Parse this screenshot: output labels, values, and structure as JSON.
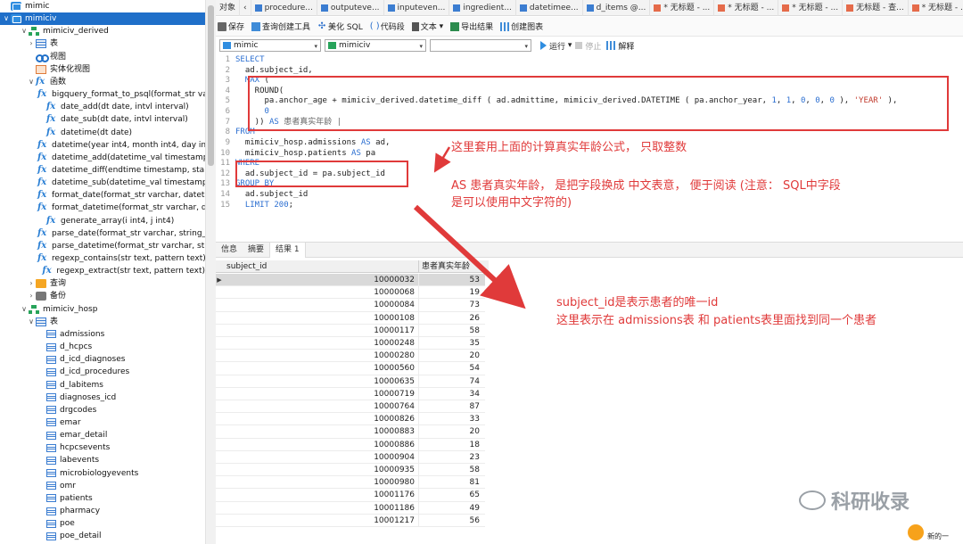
{
  "sidebar": {
    "rows": [
      {
        "label": "mimic",
        "icon": "db-icon",
        "chev": "",
        "indent": 0,
        "selected": false
      },
      {
        "label": "mimiciv",
        "icon": "db-icon",
        "chev": "∨",
        "indent": 0,
        "selected": true
      },
      {
        "label": "mimiciv_derived",
        "icon": "schema-icon",
        "chev": "∨",
        "indent": 1,
        "selected": false
      },
      {
        "label": "表",
        "icon": "table-icon",
        "chev": "›",
        "indent": 2,
        "selected": false
      },
      {
        "label": "视图",
        "icon": "view-icon",
        "chev": "",
        "indent": 2,
        "selected": false
      },
      {
        "label": "实体化视图",
        "icon": "materialized-view-icon",
        "chev": "",
        "indent": 2,
        "selected": false
      },
      {
        "label": "函数",
        "icon": "function-icon",
        "chev": "∨",
        "indent": 2,
        "selected": false
      },
      {
        "label": "bigquery_format_to_psql(format_str va",
        "icon": "function-icon",
        "chev": "",
        "indent": 3,
        "selected": false
      },
      {
        "label": "date_add(dt date, intvl interval)",
        "icon": "function-icon",
        "chev": "",
        "indent": 3,
        "selected": false
      },
      {
        "label": "date_sub(dt date, intvl interval)",
        "icon": "function-icon",
        "chev": "",
        "indent": 3,
        "selected": false
      },
      {
        "label": "datetime(dt date)",
        "icon": "function-icon",
        "chev": "",
        "indent": 3,
        "selected": false
      },
      {
        "label": "datetime(year int4, month int4, day int",
        "icon": "function-icon",
        "chev": "",
        "indent": 3,
        "selected": false
      },
      {
        "label": "datetime_add(datetime_val timestamp,",
        "icon": "function-icon",
        "chev": "",
        "indent": 3,
        "selected": false
      },
      {
        "label": "datetime_diff(endtime timestamp, start",
        "icon": "function-icon",
        "chev": "",
        "indent": 3,
        "selected": false
      },
      {
        "label": "datetime_sub(datetime_val timestamp,",
        "icon": "function-icon",
        "chev": "",
        "indent": 3,
        "selected": false
      },
      {
        "label": "format_date(format_str varchar, datetir",
        "icon": "function-icon",
        "chev": "",
        "indent": 3,
        "selected": false
      },
      {
        "label": "format_datetime(format_str varchar, da",
        "icon": "function-icon",
        "chev": "",
        "indent": 3,
        "selected": false
      },
      {
        "label": "generate_array(i int4, j int4)",
        "icon": "function-icon",
        "chev": "",
        "indent": 3,
        "selected": false
      },
      {
        "label": "parse_date(format_str varchar, string_v",
        "icon": "function-icon",
        "chev": "",
        "indent": 3,
        "selected": false
      },
      {
        "label": "parse_datetime(format_str varchar, stri",
        "icon": "function-icon",
        "chev": "",
        "indent": 3,
        "selected": false
      },
      {
        "label": "regexp_contains(str text, pattern text)",
        "icon": "function-icon",
        "chev": "",
        "indent": 3,
        "selected": false
      },
      {
        "label": "regexp_extract(str text, pattern text)",
        "icon": "function-icon",
        "chev": "",
        "indent": 3,
        "selected": false
      },
      {
        "label": "查询",
        "icon": "query-icon",
        "chev": "›",
        "indent": 2,
        "selected": false
      },
      {
        "label": "备份",
        "icon": "backup-icon",
        "chev": "›",
        "indent": 2,
        "selected": false
      },
      {
        "label": "mimiciv_hosp",
        "icon": "schema-icon",
        "chev": "∨",
        "indent": 1,
        "selected": false
      },
      {
        "label": "表",
        "icon": "table-icon",
        "chev": "∨",
        "indent": 2,
        "selected": false
      },
      {
        "label": "admissions",
        "icon": "table-small-icon",
        "chev": "",
        "indent": 3,
        "selected": false
      },
      {
        "label": "d_hcpcs",
        "icon": "table-small-icon",
        "chev": "",
        "indent": 3,
        "selected": false
      },
      {
        "label": "d_icd_diagnoses",
        "icon": "table-small-icon",
        "chev": "",
        "indent": 3,
        "selected": false
      },
      {
        "label": "d_icd_procedures",
        "icon": "table-small-icon",
        "chev": "",
        "indent": 3,
        "selected": false
      },
      {
        "label": "d_labitems",
        "icon": "table-small-icon",
        "chev": "",
        "indent": 3,
        "selected": false
      },
      {
        "label": "diagnoses_icd",
        "icon": "table-small-icon",
        "chev": "",
        "indent": 3,
        "selected": false
      },
      {
        "label": "drgcodes",
        "icon": "table-small-icon",
        "chev": "",
        "indent": 3,
        "selected": false
      },
      {
        "label": "emar",
        "icon": "table-small-icon",
        "chev": "",
        "indent": 3,
        "selected": false
      },
      {
        "label": "emar_detail",
        "icon": "table-small-icon",
        "chev": "",
        "indent": 3,
        "selected": false
      },
      {
        "label": "hcpcsevents",
        "icon": "table-small-icon",
        "chev": "",
        "indent": 3,
        "selected": false
      },
      {
        "label": "labevents",
        "icon": "table-small-icon",
        "chev": "",
        "indent": 3,
        "selected": false
      },
      {
        "label": "microbiologyevents",
        "icon": "table-small-icon",
        "chev": "",
        "indent": 3,
        "selected": false
      },
      {
        "label": "omr",
        "icon": "table-small-icon",
        "chev": "",
        "indent": 3,
        "selected": false
      },
      {
        "label": "patients",
        "icon": "table-small-icon",
        "chev": "",
        "indent": 3,
        "selected": false
      },
      {
        "label": "pharmacy",
        "icon": "table-small-icon",
        "chev": "",
        "indent": 3,
        "selected": false
      },
      {
        "label": "poe",
        "icon": "table-small-icon",
        "chev": "",
        "indent": 3,
        "selected": false
      },
      {
        "label": "poe_detail",
        "icon": "table-small-icon",
        "chev": "",
        "indent": 3,
        "selected": false
      }
    ]
  },
  "tabs": {
    "objects_label": "对象",
    "items": [
      {
        "label": "procedure...",
        "icon": "table"
      },
      {
        "label": "outputeve...",
        "icon": "table"
      },
      {
        "label": "inputeven...",
        "icon": "table"
      },
      {
        "label": "ingredient...",
        "icon": "table"
      },
      {
        "label": "datetimee...",
        "icon": "table"
      },
      {
        "label": "d_items @...",
        "icon": "table"
      },
      {
        "label": "* 无标题 - ...",
        "icon": "query"
      },
      {
        "label": "* 无标题 - ...",
        "icon": "query"
      },
      {
        "label": "* 无标题 - ...",
        "icon": "query"
      },
      {
        "label": "无标题 - 查...",
        "icon": "query"
      },
      {
        "label": "* 无标题 - ...",
        "icon": "query"
      }
    ]
  },
  "toolbar": {
    "save": "保存",
    "build_query": "查询创建工具",
    "beautify": "美化 SQL",
    "code_snippet": "代码段",
    "text": "文本",
    "export": "导出结果",
    "create_chart": "创建图表"
  },
  "conn_bar": {
    "connection": "mimic",
    "database": "mimiciv",
    "schema": "",
    "run": "运行",
    "stop": "停止",
    "explain": "解释"
  },
  "editor": {
    "lines": [
      {
        "n": "1",
        "segs": [
          {
            "t": "SELECT",
            "c": "kw"
          }
        ]
      },
      {
        "n": "2",
        "segs": [
          {
            "t": "  ad.subject_id,",
            "c": ""
          }
        ]
      },
      {
        "n": "3",
        "segs": [
          {
            "t": "  ",
            "c": ""
          },
          {
            "t": "MAX",
            "c": "kw"
          },
          {
            "t": " (",
            "c": ""
          }
        ]
      },
      {
        "n": "4",
        "segs": [
          {
            "t": "    ROUND(",
            "c": ""
          }
        ]
      },
      {
        "n": "5",
        "segs": [
          {
            "t": "      pa.anchor_age + mimiciv_derived.datetime_diff ( ad.admittime, mimiciv_derived.DATETIME ( pa.anchor_year, ",
            "c": ""
          },
          {
            "t": "1",
            "c": "num"
          },
          {
            "t": ", ",
            "c": ""
          },
          {
            "t": "1",
            "c": "num"
          },
          {
            "t": ", ",
            "c": ""
          },
          {
            "t": "0",
            "c": "num"
          },
          {
            "t": ", ",
            "c": ""
          },
          {
            "t": "0",
            "c": "num"
          },
          {
            "t": ", ",
            "c": ""
          },
          {
            "t": "0",
            "c": "num"
          },
          {
            "t": " ), ",
            "c": ""
          },
          {
            "t": "'YEAR'",
            "c": "str"
          },
          {
            "t": " ),",
            "c": ""
          }
        ]
      },
      {
        "n": "6",
        "segs": [
          {
            "t": "      ",
            "c": ""
          },
          {
            "t": "0",
            "c": "num"
          }
        ]
      },
      {
        "n": "7",
        "segs": [
          {
            "t": "    )) ",
            "c": ""
          },
          {
            "t": "AS",
            "c": "kw"
          },
          {
            "t": " 患者真实年龄 |",
            "c": "cn"
          }
        ]
      },
      {
        "n": "8",
        "segs": [
          {
            "t": "FROM",
            "c": "kw"
          }
        ]
      },
      {
        "n": "9",
        "segs": [
          {
            "t": "  mimiciv_hosp.admissions ",
            "c": ""
          },
          {
            "t": "AS",
            "c": "kw"
          },
          {
            "t": " ad,",
            "c": ""
          }
        ]
      },
      {
        "n": "10",
        "segs": [
          {
            "t": "  mimiciv_hosp.patients ",
            "c": ""
          },
          {
            "t": "AS",
            "c": "kw"
          },
          {
            "t": " pa",
            "c": ""
          }
        ]
      },
      {
        "n": "11",
        "segs": [
          {
            "t": "WHERE",
            "c": "kw"
          }
        ]
      },
      {
        "n": "12",
        "segs": [
          {
            "t": "  ad.subject_id = pa.subject_id",
            "c": ""
          }
        ]
      },
      {
        "n": "13",
        "segs": [
          {
            "t": "GROUP BY",
            "c": "kw"
          }
        ]
      },
      {
        "n": "14",
        "segs": [
          {
            "t": "  ad.subject_id",
            "c": ""
          }
        ]
      },
      {
        "n": "15",
        "segs": [
          {
            "t": "  ",
            "c": ""
          },
          {
            "t": "LIMIT",
            "c": "kw"
          },
          {
            "t": " ",
            "c": ""
          },
          {
            "t": "200",
            "c": "num"
          },
          {
            "t": ";",
            "c": ""
          }
        ]
      }
    ]
  },
  "annotations": {
    "formula_note": "这里套用上面的计算真实年龄公式，  只取整数",
    "alias_note_1": "AS 患者真实年龄，  是把字段换成 中文表意，  便于阅读 (注意：  SQL中字段",
    "alias_note_2": "是可以使用中文字符的)",
    "join_note_1": "subject_id是表示患者的唯一id",
    "join_note_2": "这里表示在 admissions表 和 patients表里面找到同一个患者"
  },
  "result_tabs": {
    "info": "信息",
    "summary": "摘要",
    "result": "结果 1"
  },
  "grid": {
    "columns": [
      "subject_id",
      "患者真实年龄"
    ],
    "rows": [
      [
        "10000032",
        "53"
      ],
      [
        "10000068",
        "19"
      ],
      [
        "10000084",
        "73"
      ],
      [
        "10000108",
        "26"
      ],
      [
        "10000117",
        "58"
      ],
      [
        "10000248",
        "35"
      ],
      [
        "10000280",
        "20"
      ],
      [
        "10000560",
        "54"
      ],
      [
        "10000635",
        "74"
      ],
      [
        "10000719",
        "34"
      ],
      [
        "10000764",
        "87"
      ],
      [
        "10000826",
        "33"
      ],
      [
        "10000883",
        "20"
      ],
      [
        "10000886",
        "18"
      ],
      [
        "10000904",
        "23"
      ],
      [
        "10000935",
        "58"
      ],
      [
        "10000980",
        "81"
      ],
      [
        "10001176",
        "65"
      ],
      [
        "10001186",
        "49"
      ],
      [
        "10001217",
        "56"
      ]
    ]
  },
  "watermark": "科研收录",
  "corner_note": "新的一"
}
